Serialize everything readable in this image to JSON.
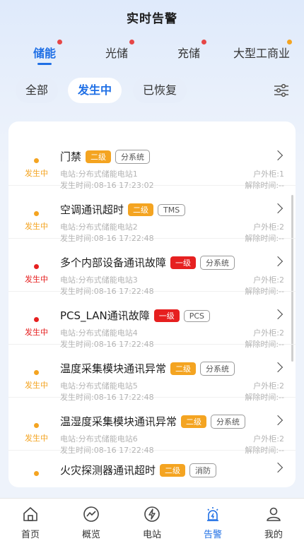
{
  "header": {
    "title": "实时告警"
  },
  "tabs": [
    {
      "label": "储能",
      "active": true,
      "dot_color": "#e64646"
    },
    {
      "label": "光储",
      "active": false,
      "dot_color": "#e64646"
    },
    {
      "label": "充储",
      "active": false,
      "dot_color": "#e64646"
    },
    {
      "label": "大型工商业",
      "active": false,
      "dot_color": "#f4a421"
    }
  ],
  "filters": [
    {
      "label": "全部",
      "active": false
    },
    {
      "label": "发生中",
      "active": true
    },
    {
      "label": "已恢复",
      "active": false
    }
  ],
  "filter_icon": "sliders-icon",
  "alarms": [
    {
      "status": "发生中",
      "status_color": "#f4a421",
      "name": "门禁",
      "level": "二级",
      "level_color": "#f4a421",
      "tag": "分系统",
      "station": "电站:分布式储能电站1",
      "time": "发生时间:08-16 17:23:02",
      "cabinet": "户外柜:1",
      "resolved": "解除时间:--"
    },
    {
      "status": "发生中",
      "status_color": "#f4a421",
      "name": "空调通讯超时",
      "level": "二级",
      "level_color": "#f4a421",
      "tag": "TMS",
      "station": "电站:分布式储能电站2",
      "time": "发生时间:08-16 17:22:48",
      "cabinet": "户外柜:2",
      "resolved": "解除时间:--"
    },
    {
      "status": "发生中",
      "status_color": "#e62020",
      "name": "多个内部设备通讯故障",
      "level": "一级",
      "level_color": "#e62020",
      "tag": "分系统",
      "station": "电站:分布式储能电站3",
      "time": "发生时间:08-16 17:22:48",
      "cabinet": "户外柜:2",
      "resolved": "解除时间:--"
    },
    {
      "status": "发生中",
      "status_color": "#e62020",
      "name": "PCS_LAN通讯故障",
      "level": "一级",
      "level_color": "#e62020",
      "tag": "PCS",
      "station": "电站:分布式储能电站4",
      "time": "发生时间:08-16 17:22:48",
      "cabinet": "户外柜:2",
      "resolved": "解除时间:--"
    },
    {
      "status": "发生中",
      "status_color": "#f4a421",
      "name": "温度采集模块通讯异常",
      "level": "二级",
      "level_color": "#f4a421",
      "tag": "分系统",
      "station": "电站:分布式储能电站5",
      "time": "发生时间:08-16 17:22:48",
      "cabinet": "户外柜:2",
      "resolved": "解除时间:--"
    },
    {
      "status": "发生中",
      "status_color": "#f4a421",
      "name": "温湿度采集模块通讯异常",
      "level": "二级",
      "level_color": "#f4a421",
      "tag": "分系统",
      "station": "电站:分布式储能电站6",
      "time": "发生时间:08-16 17:22:48",
      "cabinet": "户外柜:2",
      "resolved": "解除时间:--"
    },
    {
      "status": "",
      "status_color": "#f4a421",
      "name": "火灾探测器通讯超时",
      "level": "二级",
      "level_color": "#f4a421",
      "tag": "消防",
      "station": "",
      "time": "",
      "cabinet": "",
      "resolved": ""
    }
  ],
  "nav": [
    {
      "label": "首页",
      "icon": "home-icon",
      "active": false
    },
    {
      "label": "概览",
      "icon": "chart-circle-icon",
      "active": false
    },
    {
      "label": "电站",
      "icon": "power-station-icon",
      "active": false
    },
    {
      "label": "告警",
      "icon": "alarm-icon",
      "active": true
    },
    {
      "label": "我的",
      "icon": "user-icon",
      "active": false
    }
  ],
  "colors": {
    "accent": "#1f6fe5",
    "level1": "#e62020",
    "level2": "#f4a421"
  }
}
